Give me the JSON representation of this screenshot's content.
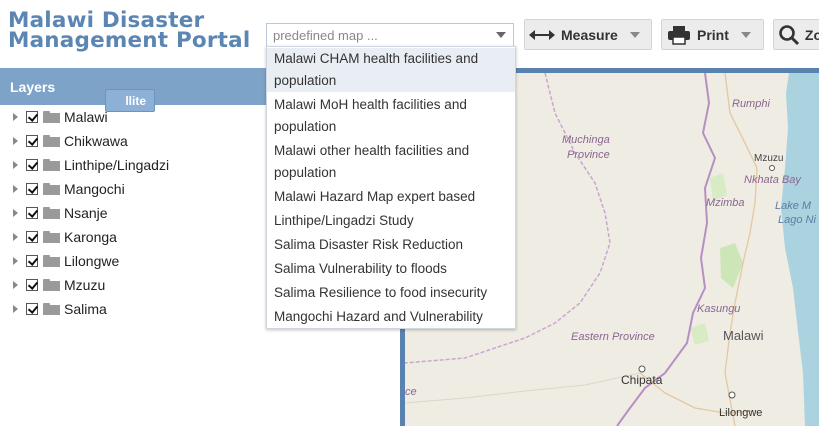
{
  "header": {
    "title_line1": "Malawi Disaster",
    "title_line2": "Management Portal"
  },
  "toolbar": {
    "map_select": {
      "placeholder": "predefined map ...",
      "value": ""
    },
    "measure_label": "Measure",
    "print_label": "Print",
    "zoom_label": "Zo"
  },
  "layers": {
    "title": "Layers",
    "items": [
      {
        "label": "Malawi",
        "checked": true
      },
      {
        "label": "Chikwawa",
        "checked": true
      },
      {
        "label": "Linthipe/Lingadzi",
        "checked": true
      },
      {
        "label": "Mangochi",
        "checked": true
      },
      {
        "label": "Nsanje",
        "checked": true
      },
      {
        "label": "Karonga",
        "checked": true
      },
      {
        "label": "Lilongwe",
        "checked": true
      },
      {
        "label": "Mzuzu",
        "checked": true
      },
      {
        "label": "Salima",
        "checked": true
      }
    ]
  },
  "dropdown": {
    "options": [
      {
        "line1": "Malawi CHAM health facilities and",
        "line2": "population",
        "highlighted": true
      },
      {
        "line1": "Malawi MoH health facilities and",
        "line2": "population",
        "highlighted": false
      },
      {
        "line1": "Malawi other health facilities and",
        "line2": "population",
        "highlighted": false
      },
      {
        "line1": "Malawi Hazard Map expert based",
        "line2": "",
        "highlighted": false
      },
      {
        "line1": "Linthipe/Lingadzi Study",
        "line2": "",
        "highlighted": false
      },
      {
        "line1": "Salima Disaster Risk Reduction",
        "line2": "",
        "highlighted": false
      },
      {
        "line1": "Salima Vulnerability to floods",
        "line2": "",
        "highlighted": false
      },
      {
        "line1": "Salima Resilience to food insecurity",
        "line2": "",
        "highlighted": false
      },
      {
        "line1": "Mangochi Hazard and Vulnerability",
        "line2": "",
        "highlighted": false
      }
    ]
  },
  "map": {
    "satellite_button": "llite",
    "labels": {
      "rumphi": "Rumphi",
      "muchinga1": "Muchinga",
      "muchinga2": "Province",
      "mzuzu": "Mzuzu",
      "nkhata": "Nkhata Bay",
      "mzimba": "Mzimba",
      "lake1": "Lake M",
      "lake2": "Lago Ni",
      "kasungu": "Kasungu",
      "eastern": "Eastern Province",
      "malawi": "Malawi",
      "chipata": "Chipata",
      "lilongwe": "Lilongwe",
      "ce": "ce"
    }
  },
  "colors": {
    "title": "#5b86b3",
    "panel_header": "#7ea3c8",
    "lake": "#aad3df",
    "land": "#efece4",
    "border": "#b78fc2"
  }
}
